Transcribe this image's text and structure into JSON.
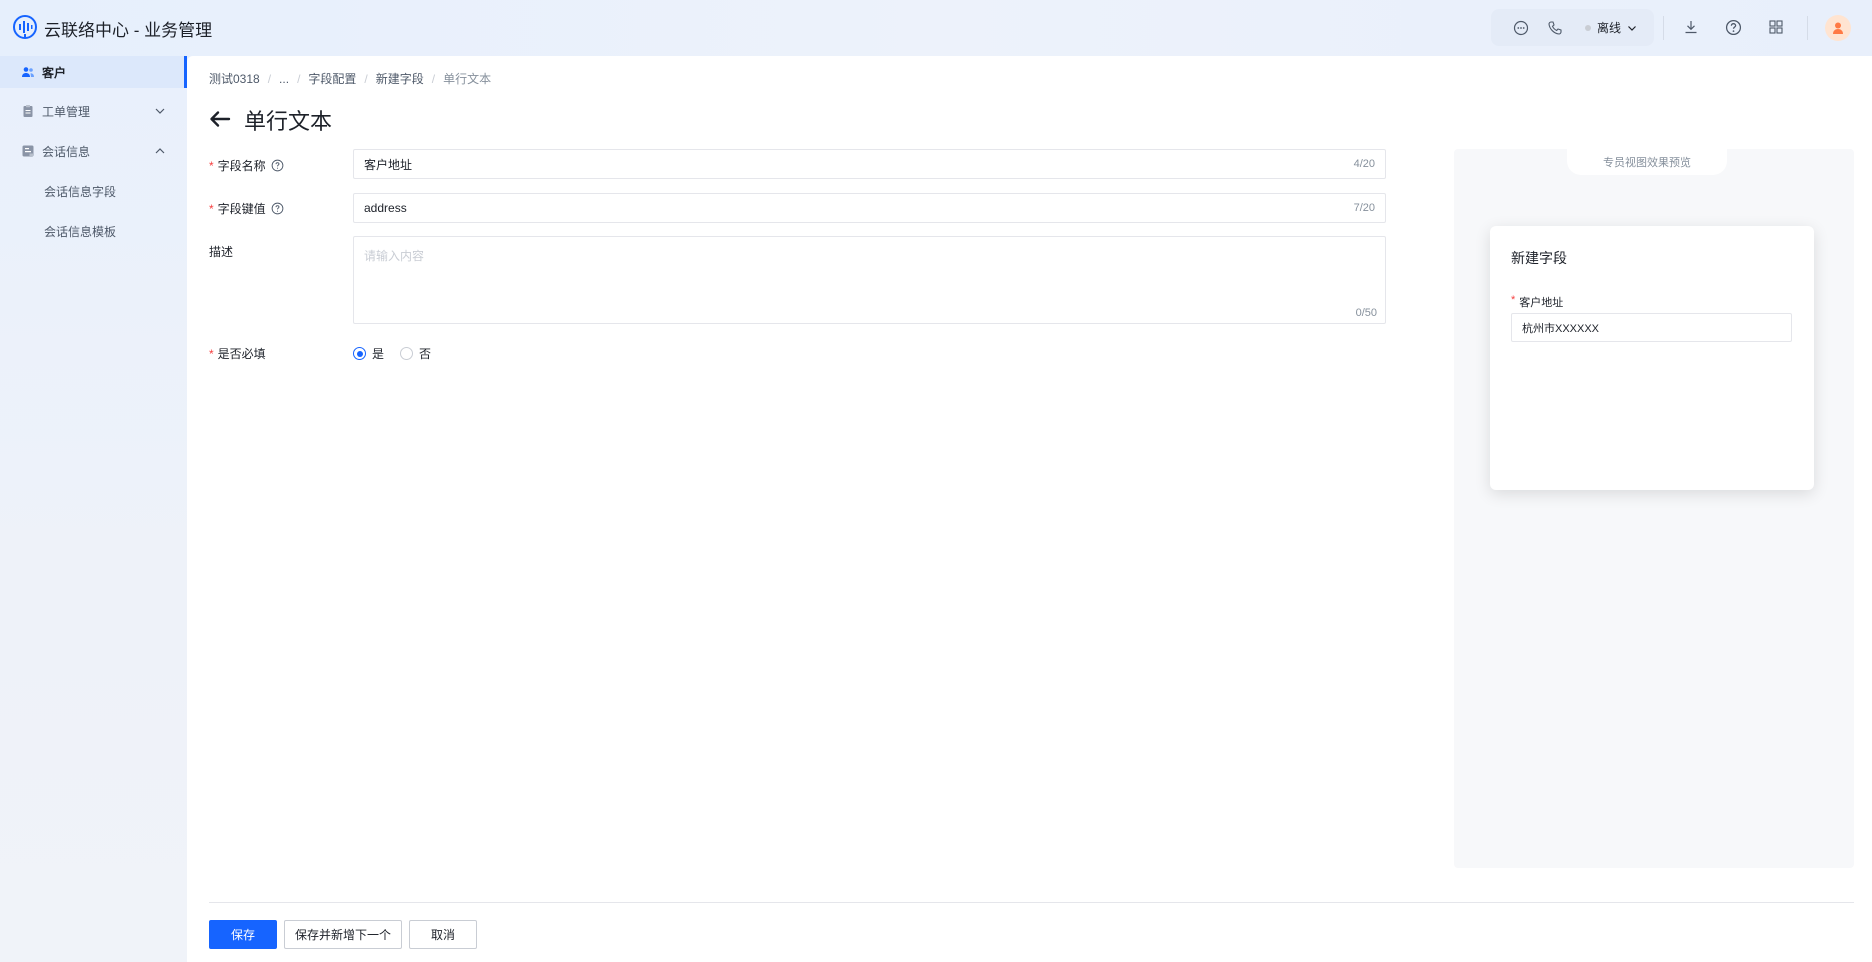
{
  "app": {
    "title": "云联络中心 - 业务管理"
  },
  "header": {
    "status_label": "离线",
    "icons": [
      "chat-icon",
      "phone-icon",
      "download-icon",
      "help-icon",
      "apps-grid-icon"
    ]
  },
  "sidebar": {
    "items": [
      {
        "label": "客户",
        "icon": "users-icon",
        "active": true
      },
      {
        "label": "工单管理",
        "icon": "clipboard-icon",
        "expanded": false
      },
      {
        "label": "会话信息",
        "icon": "chat-info-icon",
        "expanded": true
      },
      {
        "label": "会话信息字段"
      },
      {
        "label": "会话信息模板"
      }
    ]
  },
  "breadcrumb": [
    "测试0318",
    "...",
    "字段配置",
    "新建字段",
    "单行文本"
  ],
  "page": {
    "title": "单行文本"
  },
  "form": {
    "field_name": {
      "label": "字段名称",
      "value": "客户地址",
      "counter": "4/20"
    },
    "field_key": {
      "label": "字段键值",
      "value": "address",
      "counter": "7/20"
    },
    "description": {
      "label": "描述",
      "placeholder": "请输入内容",
      "counter": "0/50"
    },
    "required": {
      "label": "是否必填",
      "options": [
        "是",
        "否"
      ],
      "selected": "是"
    }
  },
  "preview": {
    "tab_label": "专员视图效果预览",
    "card_title": "新建字段",
    "field_label": "客户地址",
    "field_value": "杭州市XXXXXX"
  },
  "footer": {
    "save": "保存",
    "save_and_new": "保存并新增下一个",
    "cancel": "取消"
  },
  "colors": {
    "primary": "#1664ff",
    "required": "#f53f3f"
  }
}
